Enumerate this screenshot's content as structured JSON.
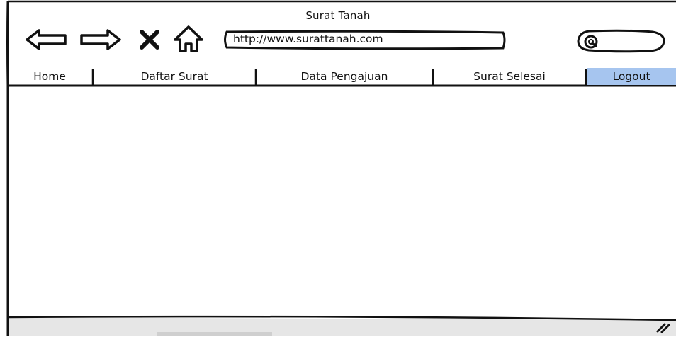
{
  "window": {
    "title": "Surat Tanah"
  },
  "toolbar": {
    "back_icon": "back-arrow-icon",
    "forward_icon": "forward-arrow-icon",
    "stop_icon": "close-icon",
    "home_icon": "home-icon",
    "search_icon": "search-icon"
  },
  "address_bar": {
    "value": "http://www.surattanah.com"
  },
  "nav": {
    "tabs": [
      {
        "label": "Home",
        "active": false
      },
      {
        "label": "Daftar Surat",
        "active": false
      },
      {
        "label": "Data Pengajuan",
        "active": false
      },
      {
        "label": "Surat Selesai",
        "active": false
      },
      {
        "label": "Logout",
        "active": true
      }
    ]
  },
  "colors": {
    "active_tab": "#a6c5ef",
    "status_bar": "#e6e6e6",
    "ink": "#111111"
  }
}
